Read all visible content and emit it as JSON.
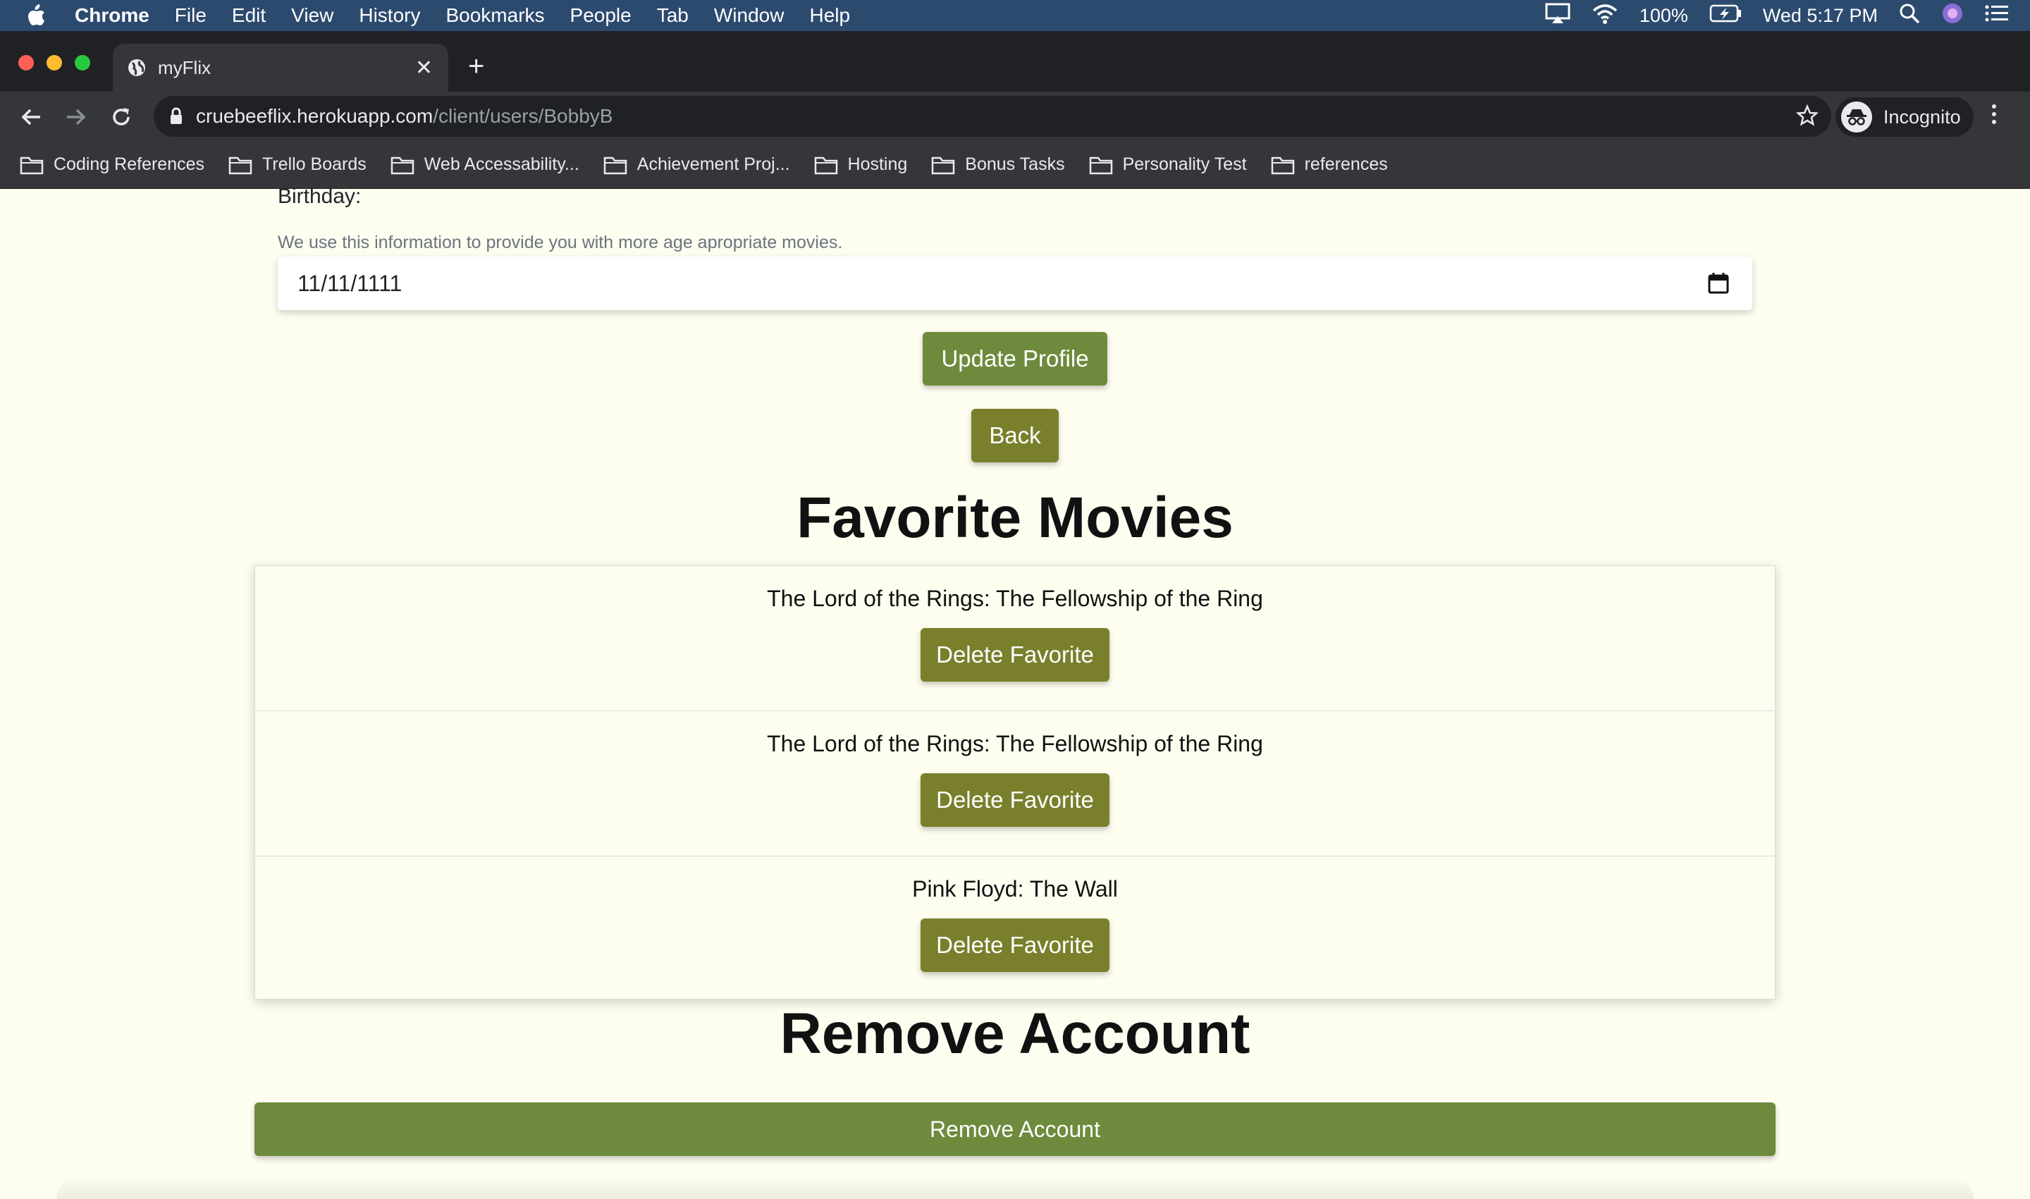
{
  "menubar": {
    "app_name": "Chrome",
    "items": [
      "File",
      "Edit",
      "View",
      "History",
      "Bookmarks",
      "People",
      "Tab",
      "Window",
      "Help"
    ],
    "battery": "100%",
    "clock": "Wed 5:17 PM"
  },
  "browser": {
    "tab_title": "myFlix",
    "url_host": "cruebeeflix.herokuapp.com",
    "url_path": "/client/users/BobbyB",
    "incognito_label": "Incognito",
    "bookmarks": [
      "Coding References",
      "Trello Boards",
      "Web Accessability...",
      "Achievement Proj...",
      "Hosting",
      "Bonus Tasks",
      "Personality Test",
      "references"
    ]
  },
  "profile_form": {
    "birthday_label": "Birthday:",
    "birthday_help": "We use this information to provide you with more age apropriate movies.",
    "birthday_value": "11/11/1111",
    "update_button": "Update Profile",
    "back_button": "Back"
  },
  "favorites": {
    "heading": "Favorite Movies",
    "items": [
      {
        "title": "The Lord of the Rings: The Fellowship of the Ring",
        "button": "Delete Favorite"
      },
      {
        "title": "The Lord of the Rings: The Fellowship of the Ring",
        "button": "Delete Favorite"
      },
      {
        "title": "Pink Floyd: The Wall",
        "button": "Delete Favorite"
      }
    ]
  },
  "remove_account": {
    "heading": "Remove Account",
    "button": "Remove Account"
  },
  "colors": {
    "menubar_bg": "#2c4a6e",
    "primary_green": "#6e8b3d",
    "olive": "#7a7f2c",
    "page_bg": "#fdfdf0"
  }
}
